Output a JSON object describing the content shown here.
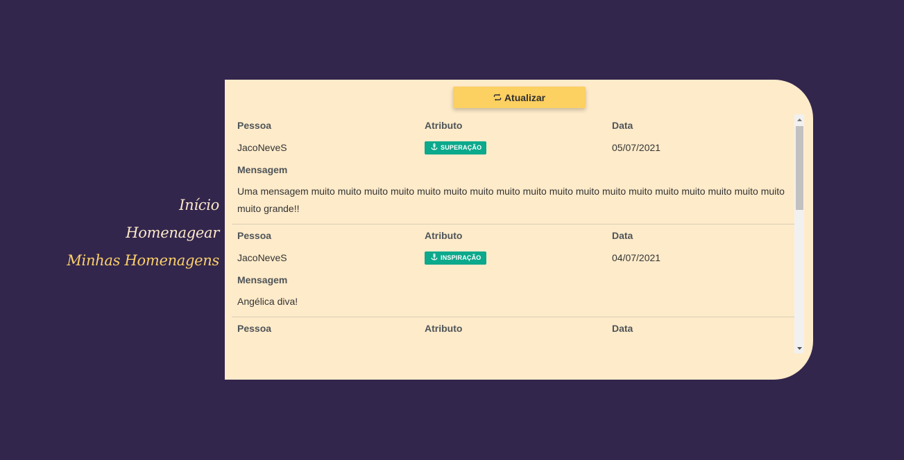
{
  "nav": {
    "items": [
      {
        "label": "Início",
        "active": false
      },
      {
        "label": "Homenagear",
        "active": false
      },
      {
        "label": "Minhas Homenagens",
        "active": true
      }
    ]
  },
  "toolbar": {
    "refresh_label": "Atualizar",
    "refresh_icon": "refresh-icon"
  },
  "labels": {
    "person": "Pessoa",
    "attribute": "Atributo",
    "date": "Data",
    "message": "Mensagem"
  },
  "tributes": [
    {
      "person": "JacoNeveS",
      "attribute": "SUPERAÇÃO",
      "attribute_icon": "anchor-icon",
      "date": "05/07/2021",
      "message": "Uma mensagem muito muito muito muito muito muito muito muito muito muito muito muito muito muito muito muito muito muito muito grande!!"
    },
    {
      "person": "JacoNeveS",
      "attribute": "INSPIRAÇÃO",
      "attribute_icon": "anchor-icon",
      "date": "04/07/2021",
      "message": "Angélica diva!"
    }
  ],
  "colors": {
    "background": "#32264d",
    "panel": "#feebca",
    "accent": "#fcd061",
    "badge": "#0ca98c",
    "nav_text": "#fde9c9",
    "nav_active": "#fcd06a"
  }
}
